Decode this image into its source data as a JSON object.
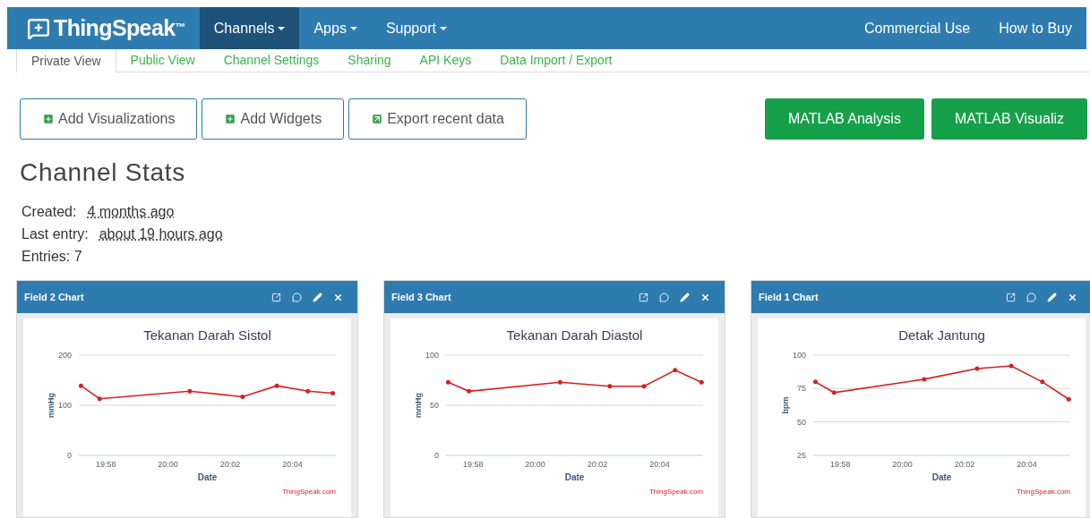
{
  "navbar": {
    "logo": "ThingSpeak",
    "trademark": "™",
    "menus": [
      {
        "label": "Channels",
        "selected": true,
        "caret": true
      },
      {
        "label": "Apps",
        "selected": false,
        "caret": true
      },
      {
        "label": "Support",
        "selected": false,
        "caret": true
      }
    ],
    "right_links": [
      "Commercial Use",
      "How to Buy"
    ]
  },
  "tabs": [
    {
      "label": "Private View",
      "selected": true
    },
    {
      "label": "Public View",
      "selected": false
    },
    {
      "label": "Channel Settings",
      "selected": false
    },
    {
      "label": "Sharing",
      "selected": false
    },
    {
      "label": "API Keys",
      "selected": false
    },
    {
      "label": "Data Import / Export",
      "selected": false
    }
  ],
  "action_buttons": [
    {
      "label": "Add Visualizations",
      "kind": "plus"
    },
    {
      "label": "Add Widgets",
      "kind": "plus"
    },
    {
      "label": "Export recent data",
      "kind": "export"
    }
  ],
  "matlab_buttons": [
    "MATLAB Analysis",
    "MATLAB Visualiz"
  ],
  "channel_stats": {
    "title": "Channel Stats",
    "rows": [
      {
        "label": "Created:",
        "value": "4 months ago"
      },
      {
        "label": "Last entry:",
        "value": "about 19 hours ago"
      }
    ],
    "entries": "Entries: 7"
  },
  "widgets": [
    {
      "title": "Field 2 Chart",
      "credit": "ThingSpeak.com",
      "chart_data": {
        "type": "line",
        "title": "Tekanan Darah Sistol",
        "xlabel": "Date",
        "ylabel": "mmHg",
        "x": [
          1197.2,
          1197.8,
          1200.7,
          1202.4,
          1203.5,
          1204.5,
          1205.3
        ],
        "xlim": [
          1197.13,
          1205.4
        ],
        "ylim": [
          0,
          200
        ],
        "yticks": [
          0,
          100,
          200
        ],
        "xticks": [
          {
            "value": 1198,
            "label": "19:58"
          },
          {
            "value": 1200,
            "label": "20:00"
          },
          {
            "value": 1202,
            "label": "20:02"
          },
          {
            "value": 1204,
            "label": "20:04"
          }
        ],
        "series": [
          {
            "color": "#d62020",
            "values": [
              139,
              113,
              128,
              117,
              139,
              128,
              124
            ]
          }
        ]
      }
    },
    {
      "title": "Field 3 Chart",
      "credit": "ThingSpeak.com",
      "chart_data": {
        "type": "line",
        "title": "Tekanan Darah Diastol",
        "xlabel": "Date",
        "ylabel": "mmHg",
        "x": [
          1197.2,
          1197.87,
          1200.8,
          1202.4,
          1203.5,
          1204.5,
          1205.35
        ],
        "xlim": [
          1197.13,
          1205.4
        ],
        "ylim": [
          0,
          100
        ],
        "yticks": [
          0,
          50,
          100
        ],
        "xticks": [
          {
            "value": 1198,
            "label": "19:58"
          },
          {
            "value": 1200,
            "label": "20:00"
          },
          {
            "value": 1202,
            "label": "20:02"
          },
          {
            "value": 1204,
            "label": "20:04"
          }
        ],
        "series": [
          {
            "color": "#d62020",
            "values": [
              73,
              64,
              73,
              69,
              69,
              85,
              73
            ]
          }
        ]
      }
    },
    {
      "title": "Field 1 Chart",
      "credit": "ThingSpeak.com",
      "chart_data": {
        "type": "line",
        "title": "Detak Jantung",
        "xlabel": "Date",
        "ylabel": "bpm",
        "x": [
          1197.2,
          1197.8,
          1200.7,
          1202.4,
          1203.5,
          1204.5,
          1205.35
        ],
        "xlim": [
          1197.13,
          1205.4
        ],
        "ylim": [
          25,
          100
        ],
        "yticks": [
          25,
          50,
          75,
          100
        ],
        "xticks": [
          {
            "value": 1198,
            "label": "19:58"
          },
          {
            "value": 1200,
            "label": "20:00"
          },
          {
            "value": 1202,
            "label": "20:02"
          },
          {
            "value": 1204,
            "label": "20:04"
          }
        ],
        "series": [
          {
            "color": "#d62020",
            "values": [
              80,
              72,
              82,
              90,
              92,
              80,
              67
            ]
          }
        ]
      }
    }
  ]
}
